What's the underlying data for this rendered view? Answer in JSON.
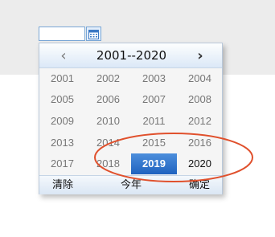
{
  "datepicker": {
    "input_value": "",
    "calendar_icon": "calendar-icon",
    "header": {
      "prev": "‹",
      "range": "2001--2020",
      "next": "›"
    },
    "years": [
      "2001",
      "2002",
      "2003",
      "2004",
      "2005",
      "2006",
      "2007",
      "2008",
      "2009",
      "2010",
      "2011",
      "2012",
      "2013",
      "2014",
      "2015",
      "2016",
      "2017",
      "2018",
      "2019",
      "2020"
    ],
    "selected_year": "2019",
    "footer": {
      "clear": "清除",
      "this_year": "今年",
      "confirm": "确定"
    }
  },
  "colors": {
    "selected_bg": "#2e72cf",
    "annotation": "#e0502c"
  }
}
